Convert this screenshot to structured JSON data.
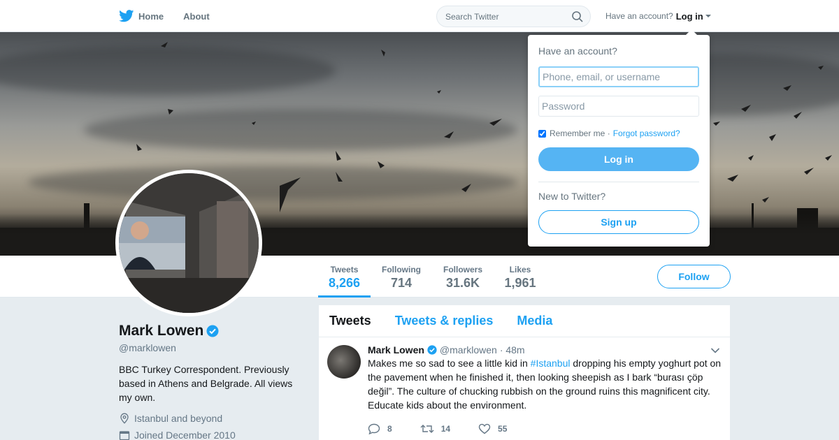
{
  "nav": {
    "home_label": "Home",
    "about_label": "About",
    "search_placeholder": "Search Twitter",
    "account_prompt": "Have an account?",
    "login_label": "Log in"
  },
  "profile": {
    "name": "Mark Lowen",
    "handle": "@marklowen",
    "bio": "BBC Turkey Correspondent. Previously based in Athens and Belgrade. All views my own.",
    "location": "Istanbul and beyond",
    "joined": "Joined December 2010"
  },
  "stats": [
    {
      "label": "Tweets",
      "value": "8,266",
      "active": true
    },
    {
      "label": "Following",
      "value": "714",
      "active": false
    },
    {
      "label": "Followers",
      "value": "31.6K",
      "active": false
    },
    {
      "label": "Likes",
      "value": "1,961",
      "active": false
    }
  ],
  "follow_label": "Follow",
  "timeline": {
    "tabs": [
      "Tweets",
      "Tweets & replies",
      "Media"
    ],
    "tweet": {
      "name": "Mark Lowen",
      "handle": "@marklowen",
      "time": "· 48m",
      "text_before": "Makes me so sad to see a little kid in ",
      "hashtag": "#Istanbul",
      "text_after": " dropping his empty yoghurt pot on the pavement when he finished it, then looking sheepish as I bark “burası çöp değil”. The culture of chucking rubbish on the ground ruins this magnificent city. Educate kids about the environment.",
      "replies": "8",
      "retweets": "14",
      "likes": "55"
    }
  },
  "login_dropdown": {
    "title": "Have an account?",
    "username_placeholder": "Phone, email, or username",
    "password_placeholder": "Password",
    "remember_label": "Remember me ·",
    "forgot_label": "Forgot password?",
    "login_button": "Log in",
    "new_prompt": "New to Twitter?",
    "signup_button": "Sign up"
  },
  "colors": {
    "accent": "#1da1f2",
    "background": "#e6ecf0",
    "muted": "#657786"
  }
}
